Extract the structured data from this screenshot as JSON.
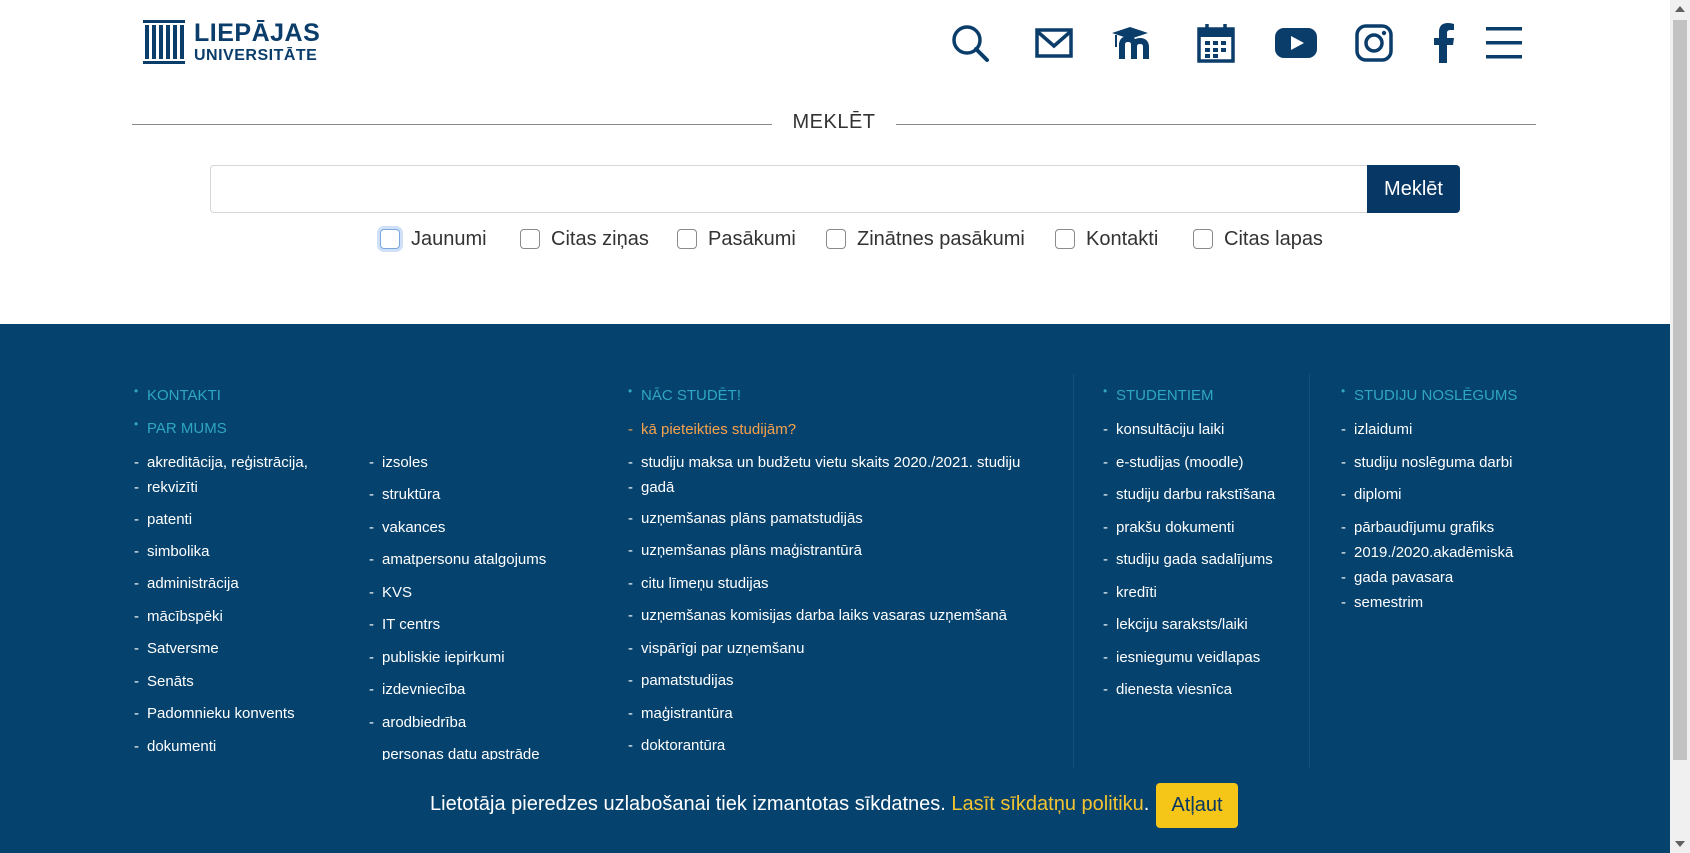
{
  "logo": {
    "line1": "LIEPĀJAS",
    "line2": "UNIVERSITĀTE"
  },
  "header_icons": [
    "search-icon",
    "mail-icon",
    "moodle-icon",
    "calendar-icon",
    "youtube-icon",
    "instagram-icon",
    "facebook-icon",
    "hamburger-menu-icon"
  ],
  "search": {
    "heading": "MEKLĒT",
    "placeholder": "",
    "button_label": "Meklēt",
    "filters": [
      "Jaunumi",
      "Citas ziņas",
      "Pasākumi",
      "Zinātnes pasākumi",
      "Kontakti",
      "Citas lapas"
    ]
  },
  "footer": {
    "col1": {
      "head1": "KONTAKTI",
      "head2": "PAR MUMS",
      "items_a": [
        "akreditācija, reģistrācija,",
        "rekvizīti",
        "patenti",
        "simbolika",
        "administrācija",
        "mācībspēki",
        "Satversme",
        "Senāts",
        "Padomnieku konvents",
        "dokumenti"
      ],
      "items_b": [
        "izsoles",
        "struktūra",
        "vakances",
        "amatpersonu atalgojums",
        "KVS",
        "IT centrs",
        "publiskie iepirkumi",
        "izdevniecība",
        "arodbiedrība",
        "personas datu apstrāde"
      ]
    },
    "col2": {
      "head": "NĀC STUDĒT!",
      "highlight": "kā pieteikties studijām?",
      "items": [
        "studiju maksa un budžetu vietu skaits 2020./2021. studiju",
        "gadā",
        "uzņemšanas plāns pamatstudijās",
        "uzņemšanas plāns maģistrantūrā",
        "citu līmeņu studijas",
        "uzņemšanas komisijas darba laiks vasaras uzņemšanā",
        "vispārīgi par uzņemšanu",
        "pamatstudijas",
        "maģistrantūra",
        "doktorantūra"
      ]
    },
    "col3": {
      "head": "STUDENTIEM",
      "items": [
        "konsultāciju laiki",
        "e-studijas (moodle)",
        "studiju darbu rakstīšana",
        "prakšu dokumenti",
        "studiju gada sadalījums",
        "kredīti",
        "lekciju saraksts/laiki",
        "iesniegumu veidlapas",
        "dienesta viesnīca"
      ]
    },
    "col4": {
      "head": "STUDIJU NOSLĒGUMS",
      "items": [
        "izlaidumi",
        "studiju noslēguma darbi",
        "diplomi",
        "pārbaudījumu grafiks",
        "2019./2020.akadēmiskā",
        "gada pavasara",
        "semestrim"
      ]
    }
  },
  "cookie": {
    "text": "Lietotāja pieredzes uzlabošanai tiek izmantotas sīkdatnes. ",
    "link": "Lasīt sīkdatņu politiku",
    "period": ".",
    "button": "Atļaut"
  },
  "colors": {
    "brand": "#073764",
    "footer_bg": "#05426e",
    "accent_link": "#f7a24b",
    "heading_teal": "#2fa6c3",
    "cookie_button": "#f5c518"
  }
}
